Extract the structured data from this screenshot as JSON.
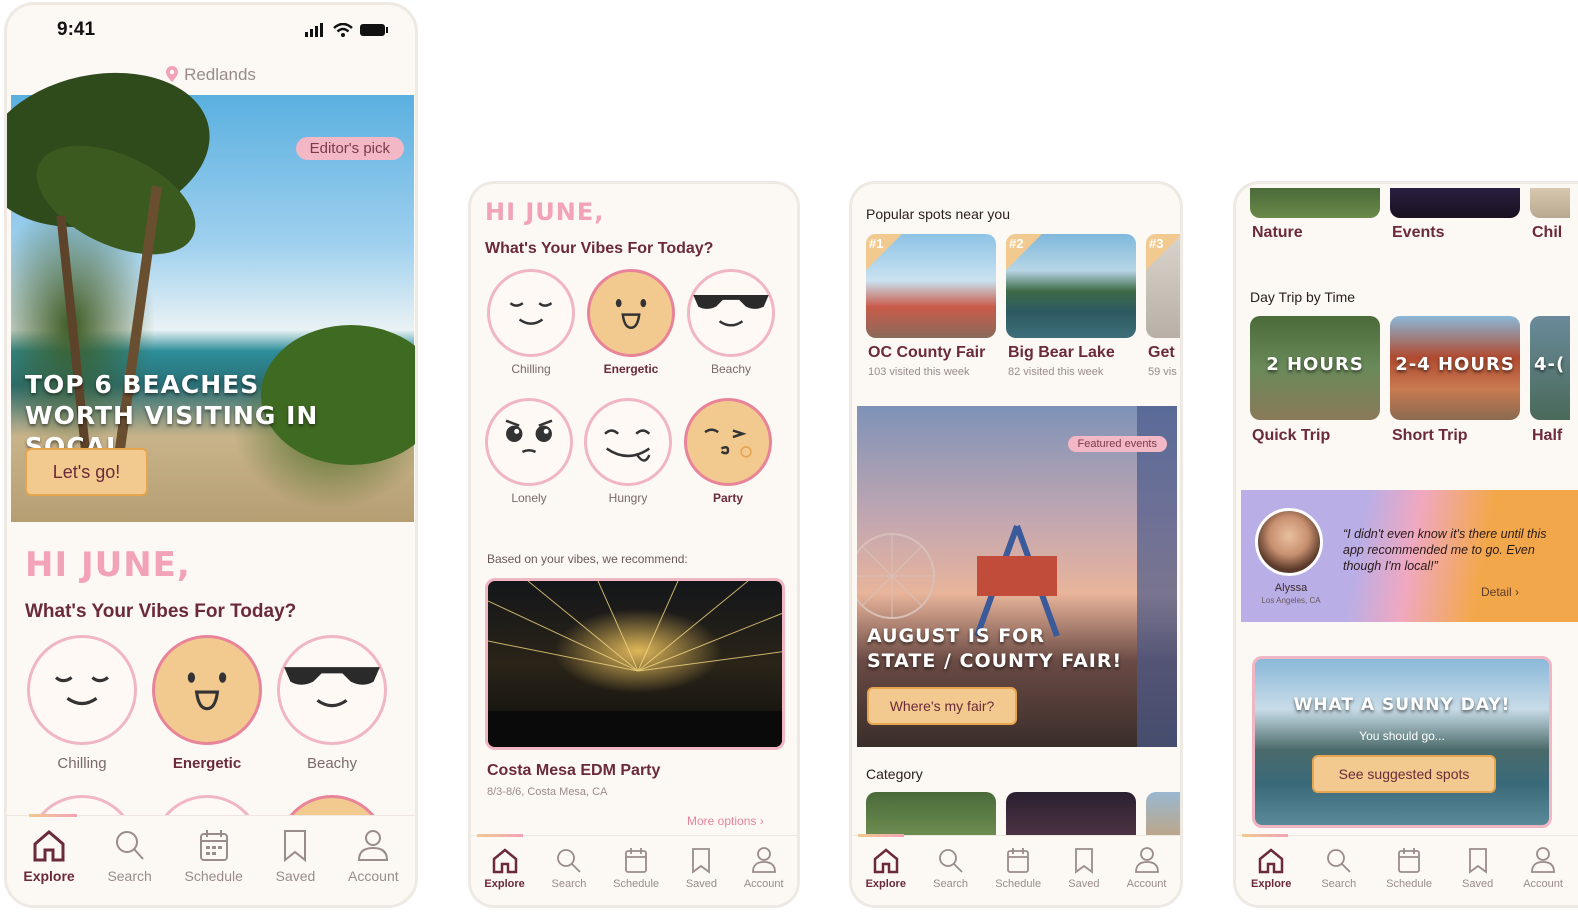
{
  "colors": {
    "accent_pink": "#f2a3b8",
    "accent_orange": "#f2c98e",
    "maroon": "#6b2a3a",
    "bg": "#fcf8f4"
  },
  "screen1": {
    "status_time": "9:41",
    "location": "Redlands",
    "hero": {
      "badge": "Editor's pick",
      "title_line1": "TOP 6 BEACHES",
      "title_line2": "WORTH VISITING IN SOCAL",
      "cta": "Let's go!"
    },
    "greeting": "HI JUNE,",
    "vibes_question": "What's Your Vibes For Today?",
    "vibes": [
      {
        "label": "Chilling",
        "icon": "chilling-face-icon",
        "active": false
      },
      {
        "label": "Energetic",
        "icon": "energetic-face-icon",
        "active": true
      },
      {
        "label": "Beachy",
        "icon": "sunglasses-face-icon",
        "active": false
      }
    ]
  },
  "screen2": {
    "greeting": "HI JUNE,",
    "vibes_question": "What's Your Vibes For Today?",
    "vibes": [
      {
        "label": "Chilling",
        "icon": "chilling-face-icon",
        "active": false
      },
      {
        "label": "Energetic",
        "icon": "energetic-face-icon",
        "active": true
      },
      {
        "label": "Beachy",
        "icon": "sunglasses-face-icon",
        "active": false
      },
      {
        "label": "Lonely",
        "icon": "lonely-face-icon",
        "active": false
      },
      {
        "label": "Hungry",
        "icon": "hungry-face-icon",
        "active": false
      },
      {
        "label": "Party",
        "icon": "party-face-icon",
        "active": true
      }
    ],
    "recommend_label": "Based on your vibes, we recommend:",
    "event": {
      "title": "Costa Mesa EDM Party",
      "meta": "8/3-8/6, Costa Mesa, CA"
    },
    "more_options": "More options"
  },
  "screen3": {
    "popular_title": "Popular spots near you",
    "spots": [
      {
        "rank": "#1",
        "name": "OC County Fair",
        "visits": "103 visited this week"
      },
      {
        "rank": "#2",
        "name": "Big Bear Lake",
        "visits": "82 visited this week"
      },
      {
        "rank": "#3",
        "name": "Get",
        "visits": "59 vis"
      }
    ],
    "featured": {
      "badge": "Featured events",
      "title_line1": "AUGUST IS FOR",
      "title_line2": "STATE / COUNTY FAIR!",
      "cta": "Where's my fair?"
    },
    "category_title": "Category"
  },
  "screen4": {
    "categories": [
      "Nature",
      "Events",
      "Chil"
    ],
    "daytrip_title": "Day Trip by Time",
    "trips": [
      {
        "overlay": "2 HOURS",
        "name": "Quick Trip"
      },
      {
        "overlay": "2-4 HOURS",
        "name": "Short Trip"
      },
      {
        "overlay": "4-(",
        "name": "Half"
      }
    ],
    "testimonial": {
      "quote": "“I didn't even know  it's there until this app recommended me to go. Even though I'm local!”",
      "name": "Alyssa",
      "place": "Los Angeles, CA",
      "detail": "Detail"
    },
    "sunny": {
      "title": "WHAT A SUNNY DAY!",
      "subtitle": "You should go...",
      "cta": "See suggested spots"
    }
  },
  "tabs": [
    {
      "label": "Explore",
      "icon": "home-icon",
      "active": true
    },
    {
      "label": "Search",
      "icon": "search-icon",
      "active": false
    },
    {
      "label": "Schedule",
      "icon": "calendar-icon",
      "active": false
    },
    {
      "label": "Saved",
      "icon": "bookmark-icon",
      "active": false
    },
    {
      "label": "Account",
      "icon": "account-icon",
      "active": false
    }
  ]
}
